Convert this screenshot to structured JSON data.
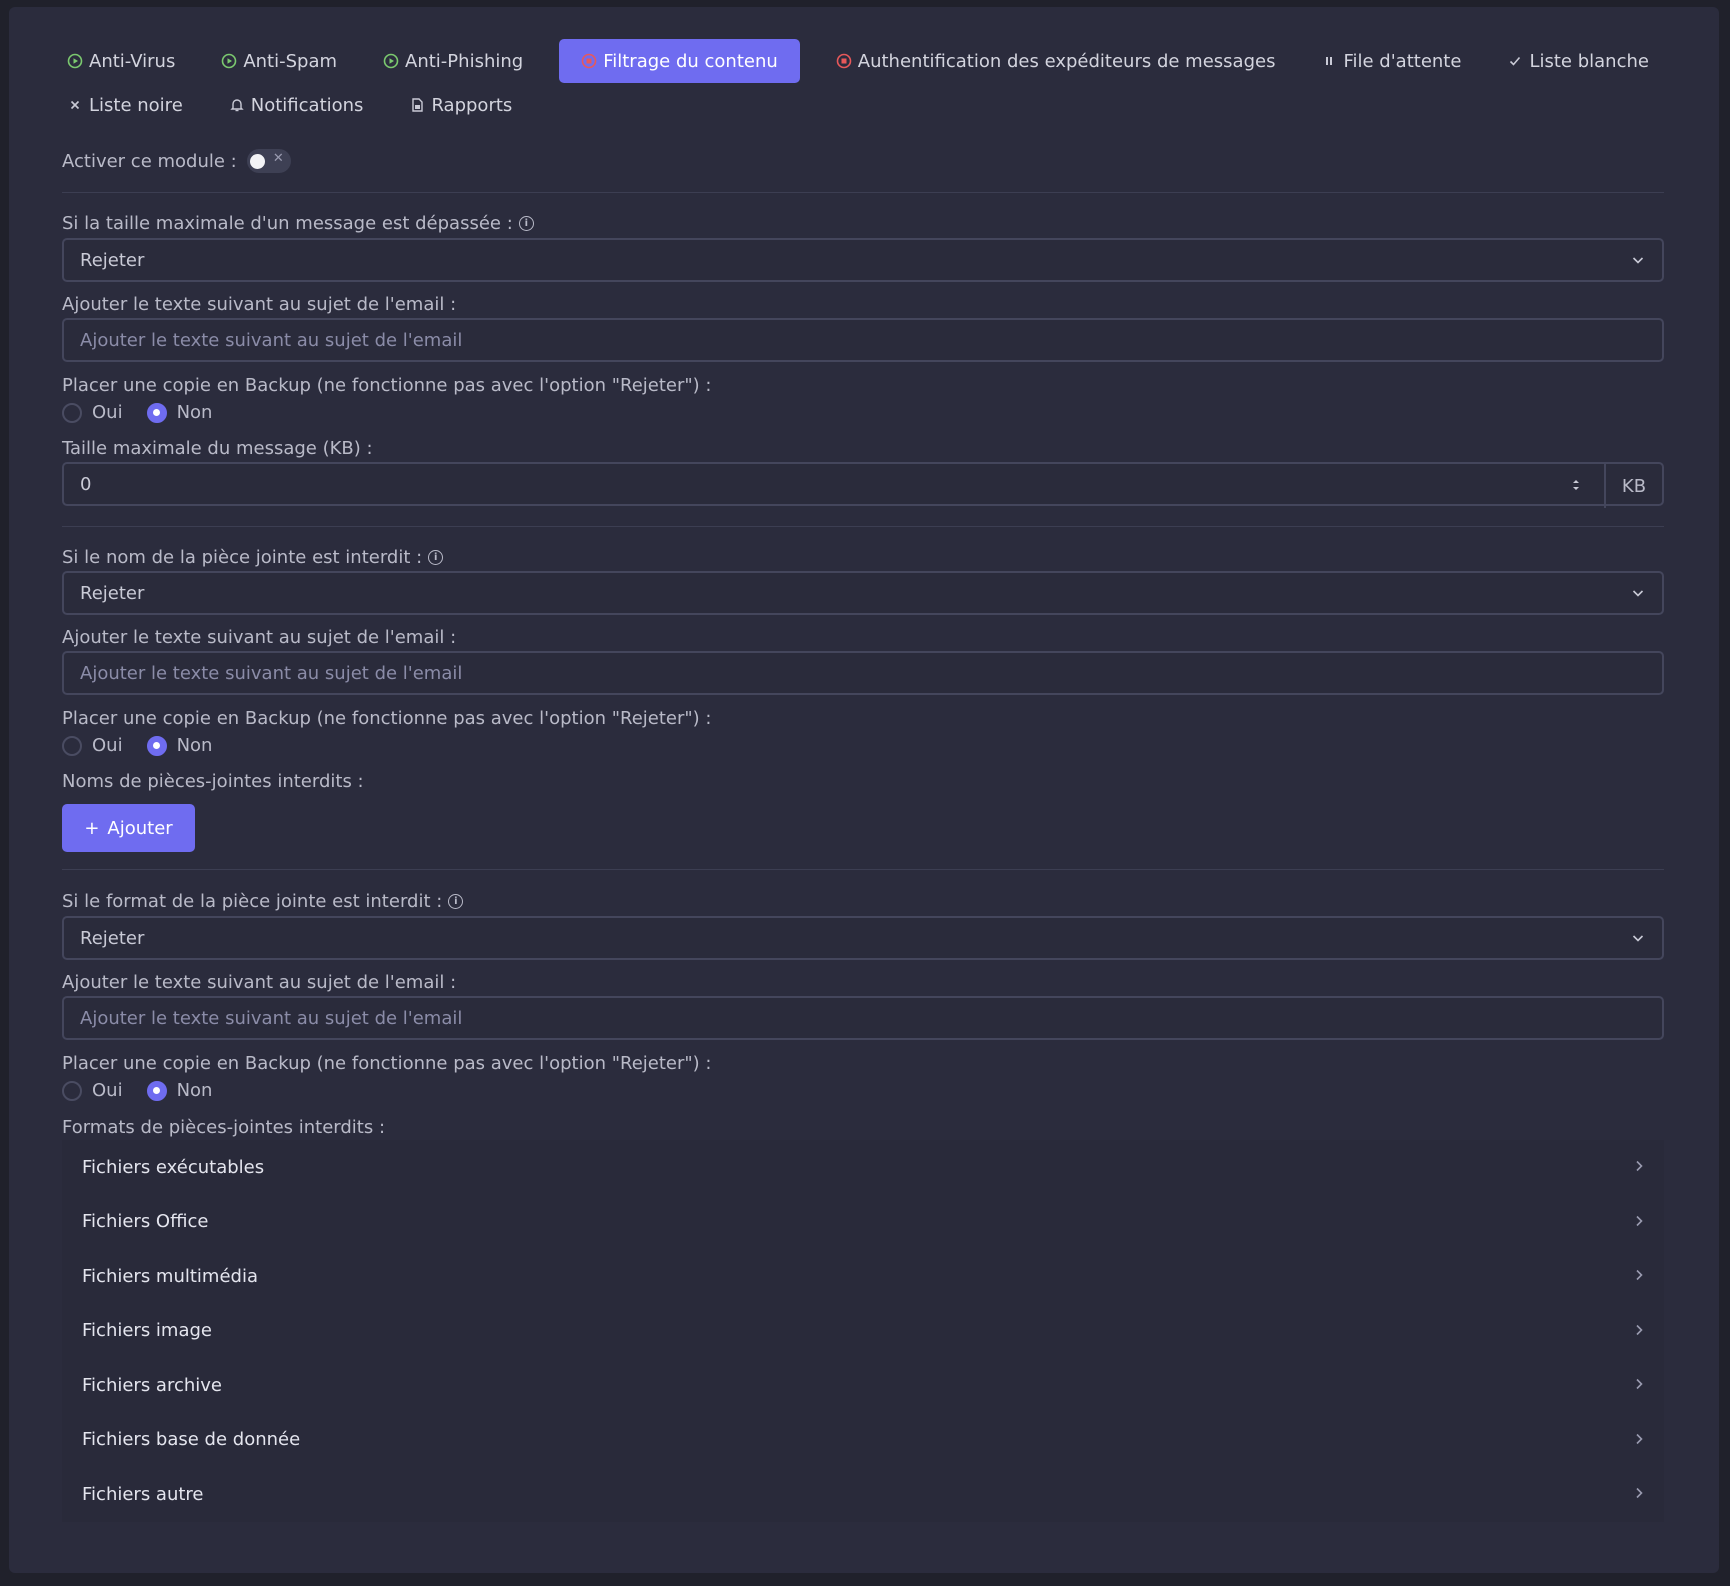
{
  "tabs_row1": [
    {
      "label": "Anti-Virus",
      "icon": "play-circle-icon"
    },
    {
      "label": "Anti-Spam",
      "icon": "play-circle-icon"
    },
    {
      "label": "Anti-Phishing",
      "icon": "play-circle-icon"
    },
    {
      "label": "Filtrage du contenu",
      "icon": "stop-circle-icon"
    },
    {
      "label": "Authentification des expéditeurs de messages",
      "icon": "stop-circle-icon"
    },
    {
      "label": "File d'attente",
      "icon": "pause-icon"
    },
    {
      "label": "Liste blanche",
      "icon": "check-icon"
    }
  ],
  "tabs_row2": [
    {
      "label": "Liste noire",
      "icon": "close-icon"
    },
    {
      "label": "Notifications",
      "icon": "bell-icon"
    },
    {
      "label": "Rapports",
      "icon": "file-icon"
    }
  ],
  "module": {
    "label": "Activer ce module :"
  },
  "section1": {
    "label": "Si la taille maximale d'un message est dépassée :",
    "select_value": "Rejeter",
    "subject_label": "Ajouter le texte suivant au sujet de l'email :",
    "subject_placeholder": "Ajouter le texte suivant au sujet de l'email",
    "backup_label": "Placer une copie en Backup (ne fonctionne pas avec l'option \"Rejeter\") :",
    "oui": "Oui",
    "non": "Non",
    "size_label": "Taille maximale du message (KB) :",
    "size_value": "0",
    "size_unit": "KB"
  },
  "section2": {
    "label": "Si le nom de la pièce jointe est interdit :",
    "select_value": "Rejeter",
    "subject_label": "Ajouter le texte suivant au sujet de l'email :",
    "subject_placeholder": "Ajouter le texte suivant au sujet de l'email",
    "backup_label": "Placer une copie en Backup (ne fonctionne pas avec l'option \"Rejeter\") :",
    "oui": "Oui",
    "non": "Non",
    "names_label": "Noms de pièces-jointes interdits :",
    "add_label": "Ajouter"
  },
  "section3": {
    "label": "Si le format de la pièce jointe est interdit :",
    "select_value": "Rejeter",
    "subject_label": "Ajouter le texte suivant au sujet de l'email :",
    "subject_placeholder": "Ajouter le texte suivant au sujet de l'email",
    "backup_label": "Placer une copie en Backup (ne fonctionne pas avec l'option \"Rejeter\") :",
    "oui": "Oui",
    "non": "Non",
    "formats_label": "Formats de pièces-jointes interdits :",
    "formats": [
      "Fichiers exécutables",
      "Fichiers Office",
      "Fichiers multimédia",
      "Fichiers image",
      "Fichiers archive",
      "Fichiers base de donnée",
      "Fichiers autre"
    ]
  },
  "colors": {
    "accent": "#6f6cf0",
    "green": "#7bc96f",
    "red": "#e8585a",
    "background": "#2b2c3d"
  }
}
